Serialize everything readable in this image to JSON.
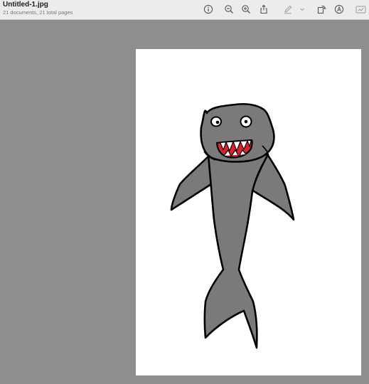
{
  "window": {
    "title": "Untitled-1.jpg",
    "subtitle": "21 documents, 21 total pages"
  },
  "toolbar": {
    "icons": [
      "info-icon",
      "zoom-out-icon",
      "zoom-in-icon",
      "share-icon",
      "markup-pen-icon",
      "chevron-down-icon",
      "rotate-icon",
      "annotate-icon",
      "form-fill-icon"
    ]
  },
  "document": {
    "image": "hand-drawn gray shark with red open mouth and teeth",
    "colors": {
      "viewer_background": "#8e8e8e",
      "page": "#ffffff",
      "shark_body": "#7a7a7a",
      "shark_outline": "#000000",
      "mouth": "#e0202a"
    }
  }
}
